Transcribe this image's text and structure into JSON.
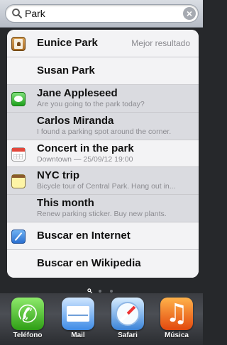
{
  "search": {
    "value": "Park"
  },
  "results": [
    {
      "title": "Eunice Park",
      "badge": "Mejor resultado",
      "icon": "contacts-icon"
    },
    {
      "title": "Susan Park"
    },
    {
      "title": "Jane Appleseed",
      "subtitle": "Are you going to the park today?",
      "icon": "messages-icon"
    },
    {
      "title": "Carlos Miranda",
      "subtitle": "I found a parking spot around the corner."
    },
    {
      "title": "Concert in the park",
      "subtitle": "Downtown — 25/09/12 19:00",
      "icon": "calendar-icon"
    },
    {
      "title": "NYC trip",
      "subtitle": "Bicycle tour of Central Park. Hang out in...",
      "icon": "notes-icon"
    },
    {
      "title": "This month",
      "subtitle": "Renew parking sticker. Buy new plants."
    },
    {
      "title": "Buscar en Internet",
      "icon": "safari-icon"
    },
    {
      "title": "Buscar en Wikipedia"
    }
  ],
  "dock": [
    {
      "label": "Teléfono",
      "icon": "phone-icon"
    },
    {
      "label": "Mail",
      "icon": "mail-icon"
    },
    {
      "label": "Safari",
      "icon": "safari-icon"
    },
    {
      "label": "Música",
      "icon": "music-icon"
    }
  ]
}
